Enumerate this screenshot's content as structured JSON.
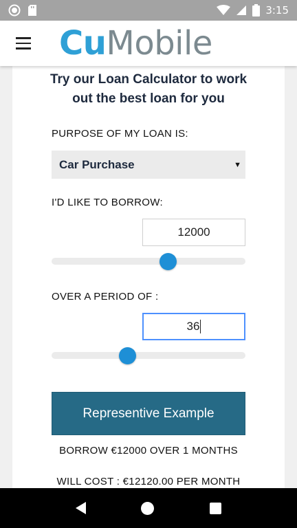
{
  "status_bar": {
    "time": "3:15",
    "icons": [
      "camera-status-icon",
      "sd-card-icon",
      "wifi-icon",
      "signal-icon",
      "battery-icon"
    ]
  },
  "app_bar": {
    "logo_part1": "Cu",
    "logo_part2": "Mobile"
  },
  "calculator": {
    "headline_line1": "Try our Loan Calculator to work",
    "headline_line2": "out the best loan for you",
    "purpose_label": "PURPOSE OF MY LOAN IS:",
    "purpose_value": "Car Purchase",
    "borrow_label": "I'D LIKE TO BORROW:",
    "borrow_value": "12000",
    "borrow_slider_fraction": 0.6,
    "period_label": "OVER A PERIOD OF :",
    "period_value": "36",
    "period_slider_fraction": 0.39,
    "button_label": "Representive Example",
    "summary_line1": "BORROW €12000 OVER 1 MONTHS",
    "summary_line2": "WILL COST : €12120.00 PER MONTH"
  },
  "colors": {
    "accent": "#2fa0d6",
    "button": "#266a86",
    "slider_thumb": "#1e8fd6",
    "headline": "#1e2a3e"
  }
}
